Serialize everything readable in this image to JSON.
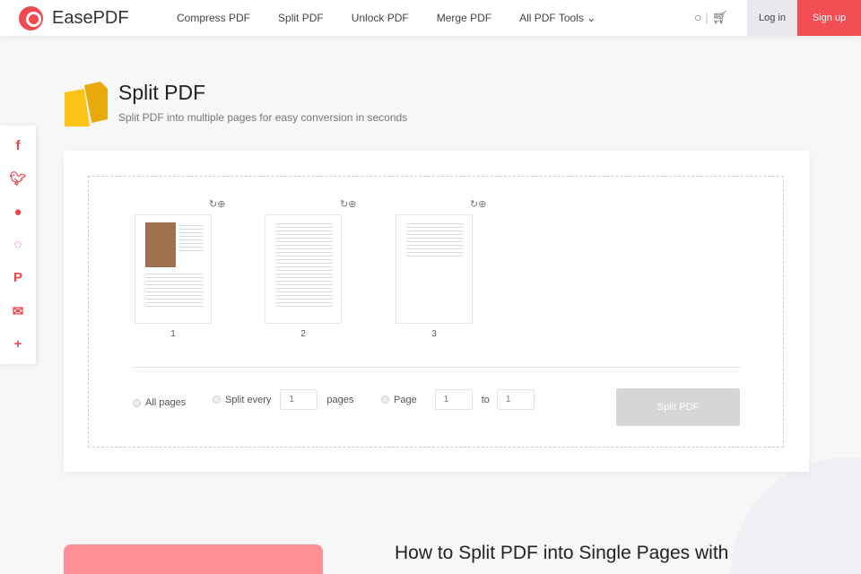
{
  "nav": {
    "brand": "EasePDF",
    "links": [
      "Compress PDF",
      "Split PDF",
      "Unlock PDF",
      "Merge PDF",
      "All PDF Tools"
    ],
    "login": "Log in",
    "signup": "Sign up"
  },
  "header": {
    "title": "Split PDF",
    "subtitle": "Split PDF into multiple pages for easy conversion in seconds"
  },
  "social": [
    "facebook",
    "twitter",
    "reddit",
    "whatsapp",
    "pinterest",
    "email",
    "more"
  ],
  "pages": [
    "1",
    "2",
    "3"
  ],
  "options": {
    "all_pages": "All pages",
    "split_every": "Split every",
    "split_every_value": "1",
    "pages": "pages",
    "page": "Page",
    "from": "1",
    "to_label": "to",
    "to": "1",
    "button": "Split PDF"
  },
  "section": {
    "heading": "How to Split PDF into Single Pages with"
  }
}
